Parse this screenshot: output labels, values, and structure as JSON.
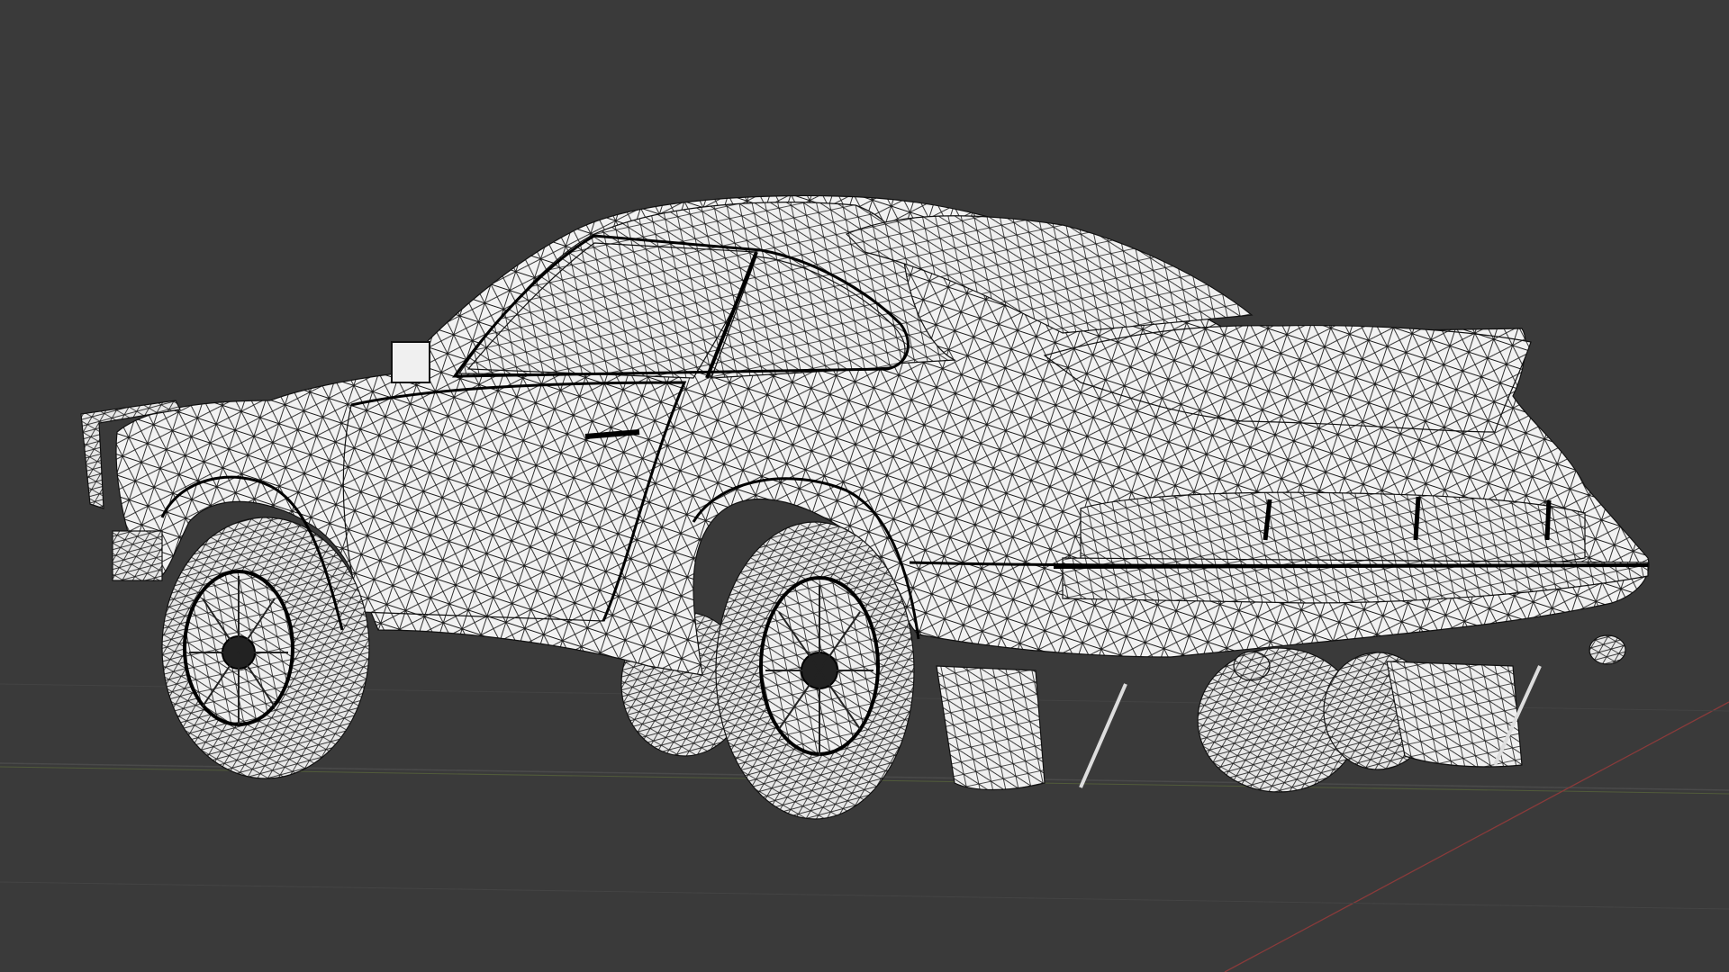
{
  "viewport": {
    "mode": "wireframe",
    "object": "car-model",
    "background_color": "#3a3a3a",
    "wire_color": "#111111",
    "surface_color": "#f2f2f2",
    "floor_grid_color": "#4a4a4a",
    "x_axis_color": "#8a3a3a",
    "y_axis_color": "#6a7a3a"
  }
}
